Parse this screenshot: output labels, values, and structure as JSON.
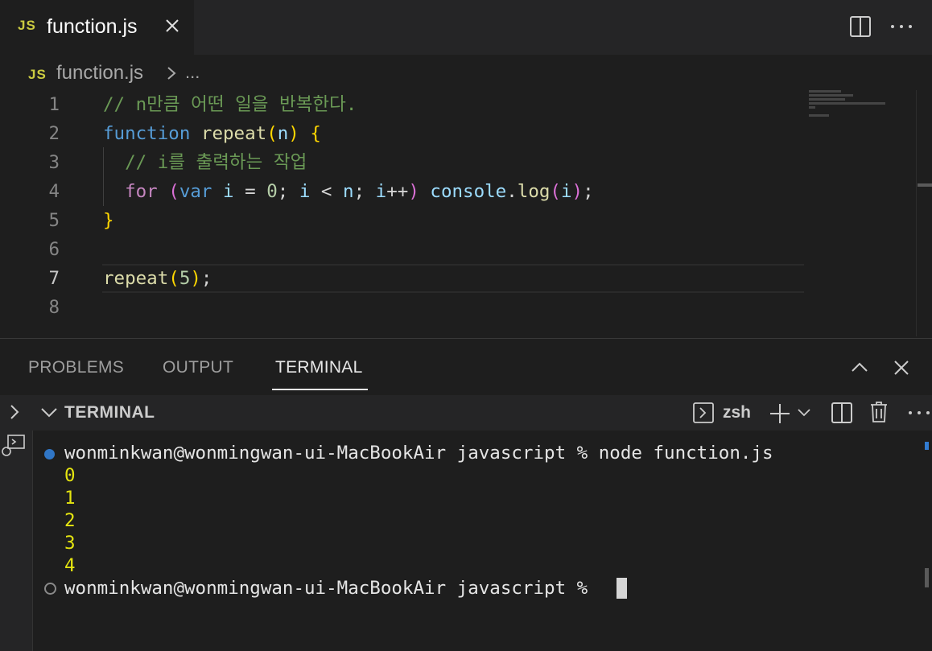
{
  "tab": {
    "lang_badge": "JS",
    "filename": "function.js"
  },
  "breadcrumb": {
    "lang_badge": "JS",
    "file": "function.js",
    "more": "..."
  },
  "editor": {
    "line_numbers": [
      "1",
      "2",
      "3",
      "4",
      "5",
      "6",
      "7",
      "8"
    ],
    "active_line": 7,
    "lines": [
      [
        {
          "t": "// n만큼 어떤 일을 반복한다.",
          "c": "comment"
        }
      ],
      [
        {
          "t": "function",
          "c": "kw"
        },
        {
          "t": " ",
          "c": "plain"
        },
        {
          "t": "repeat",
          "c": "fn"
        },
        {
          "t": "(",
          "c": "b1"
        },
        {
          "t": "n",
          "c": "var"
        },
        {
          "t": ")",
          "c": "b1"
        },
        {
          "t": " ",
          "c": "plain"
        },
        {
          "t": "{",
          "c": "b1"
        }
      ],
      [
        {
          "t": "  // i를 출력하는 작업",
          "c": "comment"
        }
      ],
      [
        {
          "t": "  ",
          "c": "plain"
        },
        {
          "t": "for",
          "c": "ctrl"
        },
        {
          "t": " ",
          "c": "plain"
        },
        {
          "t": "(",
          "c": "b2"
        },
        {
          "t": "var",
          "c": "kw"
        },
        {
          "t": " ",
          "c": "plain"
        },
        {
          "t": "i",
          "c": "var"
        },
        {
          "t": " = ",
          "c": "plain"
        },
        {
          "t": "0",
          "c": "num"
        },
        {
          "t": "; ",
          "c": "plain"
        },
        {
          "t": "i",
          "c": "var"
        },
        {
          "t": " < ",
          "c": "plain"
        },
        {
          "t": "n",
          "c": "var"
        },
        {
          "t": "; ",
          "c": "plain"
        },
        {
          "t": "i",
          "c": "var"
        },
        {
          "t": "++",
          "c": "plain"
        },
        {
          "t": ")",
          "c": "b2"
        },
        {
          "t": " ",
          "c": "plain"
        },
        {
          "t": "console",
          "c": "var"
        },
        {
          "t": ".",
          "c": "plain"
        },
        {
          "t": "log",
          "c": "fn"
        },
        {
          "t": "(",
          "c": "b2"
        },
        {
          "t": "i",
          "c": "var"
        },
        {
          "t": ")",
          "c": "b2"
        },
        {
          "t": ";",
          "c": "plain"
        }
      ],
      [
        {
          "t": "}",
          "c": "b1"
        }
      ],
      [],
      [
        {
          "t": "repeat",
          "c": "fn"
        },
        {
          "t": "(",
          "c": "b1"
        },
        {
          "t": "5",
          "c": "num"
        },
        {
          "t": ")",
          "c": "b1"
        },
        {
          "t": ";",
          "c": "plain"
        }
      ],
      []
    ]
  },
  "panel": {
    "tabs": [
      "PROBLEMS",
      "OUTPUT",
      "TERMINAL"
    ],
    "active_tab": "TERMINAL"
  },
  "terminal": {
    "header_title": "TERMINAL",
    "shell": "zsh",
    "command_line": "wonminkwan@wonmingwan-ui-MacBookAir javascript % node function.js",
    "output": [
      "0",
      "1",
      "2",
      "3",
      "4"
    ],
    "prompt": "wonminkwan@wonmingwan-ui-MacBookAir javascript % "
  },
  "colors": {
    "js_badge": "#cbcb41",
    "comment": "#6a9955",
    "keyword": "#569cd6",
    "output": "#e5e510",
    "status_dot": "#3794ff"
  }
}
